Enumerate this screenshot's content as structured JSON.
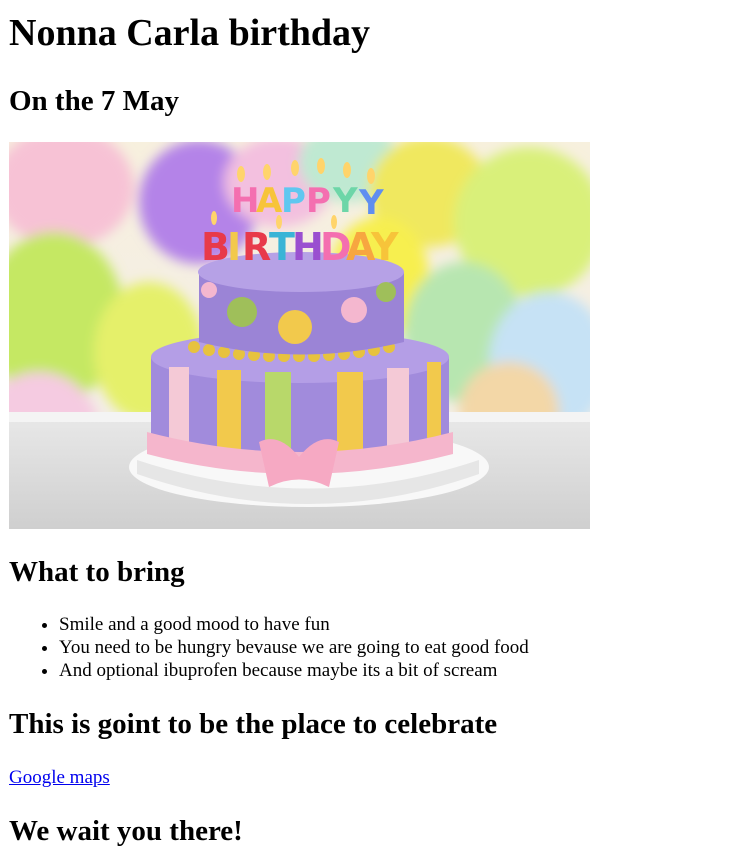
{
  "page": {
    "title": "Nonna Carla birthday",
    "date_heading": "On the 7 May",
    "bring_heading": "What to bring",
    "bring_items": [
      "Smile and a good mood to have fun",
      "You need to be hungry bevause we are going to eat good food",
      "And optional ibuprofen because maybe its a bit of scream"
    ],
    "place_heading": "This is goint to be the place to celebrate",
    "map_link_label": "Google maps",
    "closing": "We wait you there!"
  },
  "image": {
    "alt": "HAPPY BIRTHDAY cake with balloons",
    "cake_text_line1": "HAPPY",
    "cake_text_line2": "BIRTHDAY"
  },
  "colors": {
    "link": "#0000ee",
    "cake_purple": "#9b84d6",
    "cake_pink": "#f5b6cc",
    "cake_yellow": "#f2d24b",
    "cake_green": "#b8d86a",
    "balloon_yellow": "#e8ef5a",
    "balloon_green": "#b9e35d",
    "balloon_purple": "#b083e6"
  }
}
